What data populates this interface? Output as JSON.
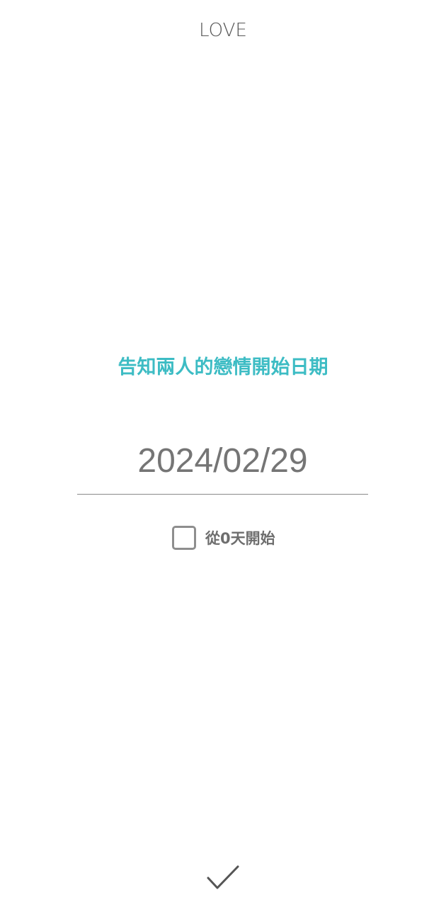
{
  "header": {
    "title": "LOVE"
  },
  "main": {
    "prompt": "告知兩人的戀情開始日期",
    "date_value": "2024/02/29",
    "start_from_zero": {
      "label": "從0天開始",
      "checked": false
    }
  },
  "footer": {
    "confirm_icon": "checkmark-icon"
  },
  "colors": {
    "accent": "#3dbcc4",
    "text_gray": "#757575",
    "border_gray": "#8e8e8e"
  }
}
